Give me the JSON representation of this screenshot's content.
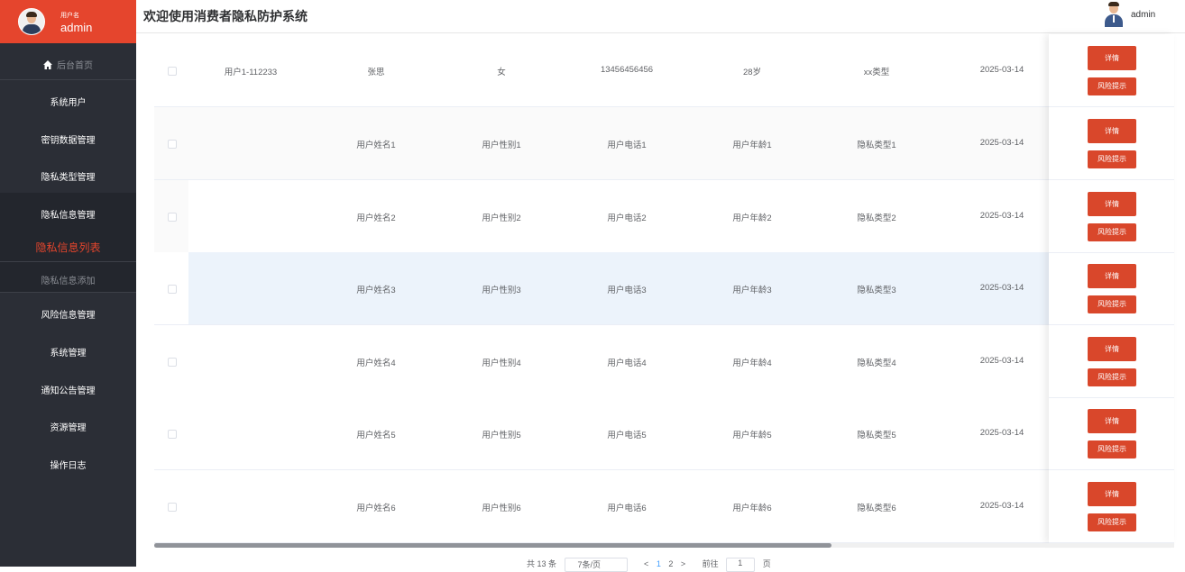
{
  "app": {
    "title": "欢迎使用消费者隐私防护系统"
  },
  "sidebar": {
    "user_caption": "用户名",
    "user_name": "admin",
    "home": "后台首页",
    "items": [
      "系统用户",
      "密钥数据管理",
      "隐私类型管理",
      "隐私信息管理",
      "隐私信息列表",
      "隐私信息添加",
      "风险信息管理",
      "系统管理",
      "通知公告管理",
      "资源管理",
      "操作日志"
    ]
  },
  "header": {
    "user": "admin"
  },
  "table": {
    "rows": [
      {
        "account": "用户1-112233",
        "name": "张思",
        "gender": "女",
        "phone": "13456456456",
        "age": "28岁",
        "type": "xx类型",
        "date": "2025-03-14"
      },
      {
        "account": "",
        "name": "用户姓名1",
        "gender": "用户性别1",
        "phone": "用户电话1",
        "age": "用户年龄1",
        "type": "隐私类型1",
        "date": "2025-03-14"
      },
      {
        "account": "",
        "name": "用户姓名2",
        "gender": "用户性别2",
        "phone": "用户电话2",
        "age": "用户年龄2",
        "type": "隐私类型2",
        "date": "2025-03-14"
      },
      {
        "account": "",
        "name": "用户姓名3",
        "gender": "用户性别3",
        "phone": "用户电话3",
        "age": "用户年龄3",
        "type": "隐私类型3",
        "date": "2025-03-14"
      },
      {
        "account": "",
        "name": "用户姓名4",
        "gender": "用户性别4",
        "phone": "用户电话4",
        "age": "用户年龄4",
        "type": "隐私类型4",
        "date": "2025-03-14"
      },
      {
        "account": "",
        "name": "用户姓名5",
        "gender": "用户性别5",
        "phone": "用户电话5",
        "age": "用户年龄5",
        "type": "隐私类型5",
        "date": "2025-03-14"
      },
      {
        "account": "",
        "name": "用户姓名6",
        "gender": "用户性别6",
        "phone": "用户电话6",
        "age": "用户年龄6",
        "type": "隐私类型6",
        "date": "2025-03-14"
      }
    ],
    "detail_label": "详情",
    "risk_label": "风险提示"
  },
  "pagination": {
    "total": "共 13 条",
    "page_size": "7条/页",
    "prev": "<",
    "page1": "1",
    "page2": "2",
    "next": ">",
    "goto": "前往",
    "goto_value": "1",
    "page_unit": "页"
  }
}
